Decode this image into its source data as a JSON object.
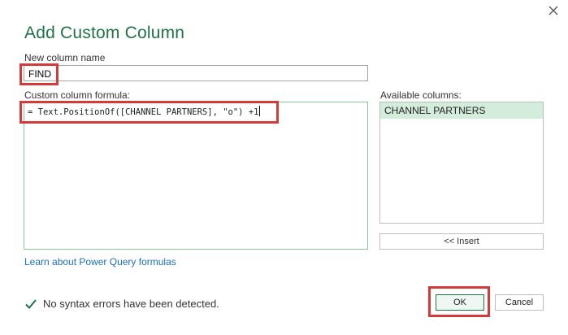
{
  "dialog": {
    "title": "Add Custom Column"
  },
  "name_field": {
    "label": "New column name",
    "value": "FIND"
  },
  "formula": {
    "label": "Custom column formula:",
    "value": "= Text.PositionOf([CHANNEL PARTNERS], \"o\") +1"
  },
  "available_columns": {
    "label": "Available columns:",
    "items": [
      "CHANNEL PARTNERS"
    ],
    "insert_label": "<< Insert"
  },
  "learn_link": "Learn about Power Query formulas",
  "status": {
    "text": "No syntax errors have been detected.",
    "icon": "checkmark-icon"
  },
  "buttons": {
    "ok": "OK",
    "cancel": "Cancel"
  },
  "colors": {
    "accent": "#217346",
    "highlight": "#d33a3a",
    "selected_row": "#d3ecdc",
    "link": "#1f6fbf"
  }
}
